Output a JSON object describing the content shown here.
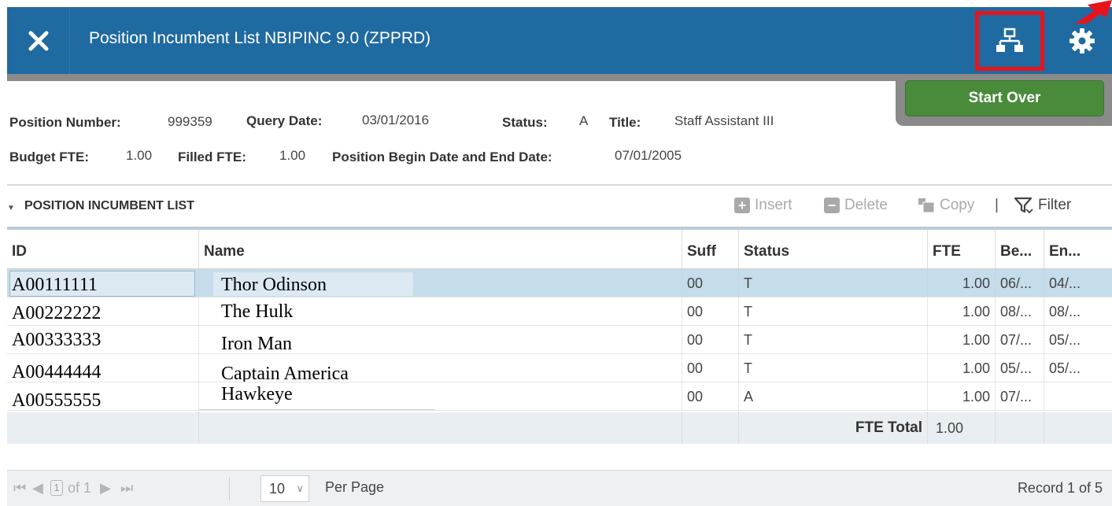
{
  "header": {
    "title": "Position Incumbent List NBIPINC 9.0 (ZPPRD)",
    "close_icon": "close-icon",
    "related_icon": "related-icon",
    "tools_icon": "gear-icon",
    "accent": "#1f6aa0",
    "highlight": "#e8141c"
  },
  "start_over": {
    "label": "Start Over",
    "color": "#4a8b3b"
  },
  "key_block": {
    "position_number_label": "Position Number:",
    "position_number": "999359",
    "query_date_label": "Query Date:",
    "query_date": "03/01/2016",
    "status_label": "Status:",
    "status": "A",
    "title_label": "Title:",
    "title": "Staff Assistant III",
    "budget_fte_label": "Budget FTE:",
    "budget_fte": "1.00",
    "filled_fte_label": "Filled FTE:",
    "filled_fte": "1.00",
    "dates_label": "Position Begin Date and End Date:",
    "dates": "07/01/2005"
  },
  "section": {
    "title": "POSITION INCUMBENT LIST",
    "insert": "Insert",
    "delete": "Delete",
    "copy": "Copy",
    "separator": "|",
    "filter": "Filter"
  },
  "table": {
    "columns": [
      "ID",
      "Name",
      "Suff",
      "Status",
      "FTE",
      "Be...",
      "En..."
    ],
    "rows": [
      {
        "id": "A00111111",
        "name": "Thor Odinson",
        "suff": "00",
        "status": "T",
        "fte": "1.00",
        "begin": "06/...",
        "end": "04/..."
      },
      {
        "id": "A00222222",
        "name": "The Hulk",
        "suff": "00",
        "status": "T",
        "fte": "1.00",
        "begin": "08/...",
        "end": "08/..."
      },
      {
        "id": "A00333333",
        "name": "Iron Man",
        "suff": "00",
        "status": "T",
        "fte": "1.00",
        "begin": "07/...",
        "end": "05/..."
      },
      {
        "id": "A00444444",
        "name": "Captain America",
        "suff": "00",
        "status": "T",
        "fte": "1.00",
        "begin": "05/...",
        "end": "05/..."
      },
      {
        "id": "A00555555",
        "name": "Hawkeye",
        "suff": "00",
        "status": "A",
        "fte": "1.00",
        "begin": "07/...",
        "end": ""
      }
    ],
    "total_label": "FTE Total",
    "total_value": "1.00"
  },
  "pager": {
    "page": "1",
    "of_pages": "of 1",
    "page_size": "10",
    "per_page_label": "Per Page",
    "record_text": "Record 1 of 5"
  }
}
